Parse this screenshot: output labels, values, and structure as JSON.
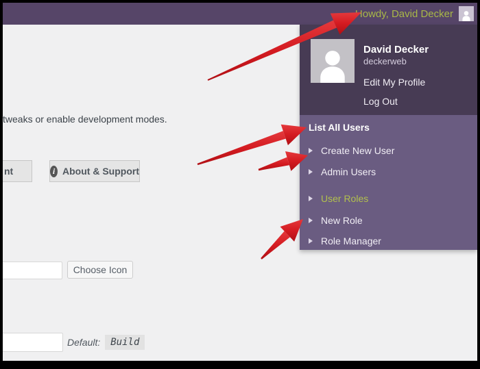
{
  "admin_bar": {
    "howdy": "Howdy, David Decker"
  },
  "dropdown": {
    "user": {
      "display_name": "David Decker",
      "username": "deckerweb"
    },
    "account_links": [
      {
        "label": "Edit My Profile"
      },
      {
        "label": "Log Out"
      }
    ],
    "users_section": {
      "heading": "List All Users",
      "items": [
        {
          "label": "Create New User"
        },
        {
          "label": "Admin Users"
        }
      ]
    },
    "roles_section": {
      "items": [
        {
          "label": "User Roles"
        },
        {
          "label": "New Role"
        },
        {
          "label": "Role Manager"
        }
      ]
    }
  },
  "content": {
    "intro_text": "tweaks or enable development modes.",
    "tabs": [
      {
        "label": "nt",
        "partial": true
      },
      {
        "label": "About & Support",
        "icon": "info"
      }
    ],
    "icon_field": {
      "value": "",
      "button_label": "Choose Icon"
    },
    "default_field": {
      "value": "",
      "default_label": "Default:",
      "default_value": "Build"
    }
  },
  "colors": {
    "admin_bar_bg": "#564568",
    "dropdown_top_bg": "#473b54",
    "dropdown_submenu_bg": "#6a5c81",
    "highlight_green": "#a9b847",
    "arrow_red": "#d41b21",
    "page_bg": "#f0f0f1"
  }
}
